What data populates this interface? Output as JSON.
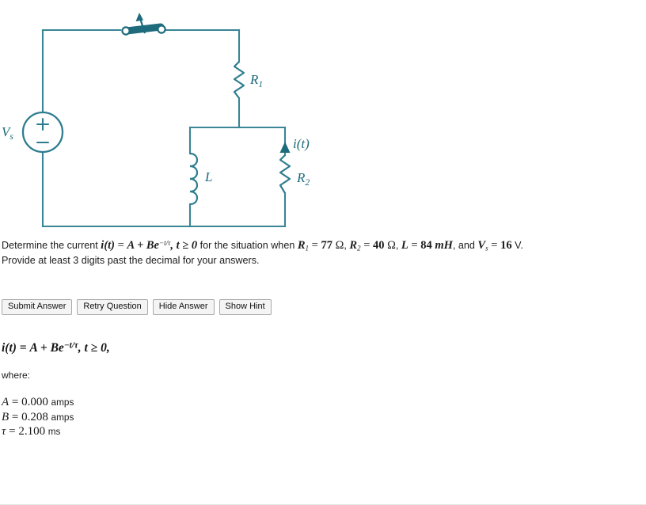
{
  "circuit": {
    "accent_color": "#2d7d8f",
    "stroke_color": "#3a8596",
    "label_color": "#1b6b7a",
    "components": {
      "source_label": "V",
      "source_sub": "s",
      "source_plus": "+",
      "source_minus": "−",
      "r1_label": "R",
      "r1_sub": "1",
      "r2_label": "R",
      "r2_sub": "2",
      "inductor_label": "L",
      "current_label": "i(t)",
      "switch_name": "switch"
    }
  },
  "problem": {
    "line1_pre": "Determine the current ",
    "eq_i": "i(t)",
    "eq_equals": " = ",
    "eq_rhs": "A + Be",
    "eq_exp": "−t/τ",
    "eq_cond": ", t ≥ 0",
    "line1_mid": " for the situation when ",
    "r1_name": "R",
    "r1_sub": "1",
    "r1_value": "77",
    "r1_unit": "Ω",
    "r2_name": "R",
    "r2_sub": "2",
    "r2_value": "40",
    "r2_unit": "Ω",
    "l_name": "L",
    "l_value": "84",
    "l_unit": "mH",
    "and_text": ", and ",
    "vs_name": "V",
    "vs_sub": "s",
    "vs_value": "16",
    "vs_unit": "V",
    "line2": "Provide at least 3 digits past the decimal for your answers."
  },
  "buttons": [
    {
      "id": "submit-answer",
      "label": "Submit Answer"
    },
    {
      "id": "retry-question",
      "label": "Retry Question"
    },
    {
      "id": "hide-answer",
      "label": "Hide Answer"
    },
    {
      "id": "show-hint",
      "label": "Show Hint"
    }
  ],
  "answer": {
    "equation_lhs": "i(t)",
    "equation_eq": " = ",
    "equation_rhs": "A + Be",
    "equation_exp": "−t/τ",
    "equation_cond": ",   t ≥ 0,",
    "where_label": "where:",
    "values": [
      {
        "symbol": "A",
        "eq": " = ",
        "number": "0.000",
        "unit": "amps"
      },
      {
        "symbol": "B",
        "eq": " = ",
        "number": "0.208",
        "unit": "amps"
      },
      {
        "symbol": "τ",
        "eq": " = ",
        "number": "2.100",
        "unit": "ms"
      }
    ]
  },
  "chart_data": {
    "type": "diagram",
    "title": "RL circuit with switch, series R1, and parallel L / R2 branch",
    "nodes": [
      "Vs source (left branch)",
      "switch (top wire)",
      "R1 (right vertical, series)",
      "L (middle vertical, parallel branch)",
      "R2 (right vertical, parallel branch, carries i(t))"
    ],
    "given": {
      "R1_ohm": 77,
      "R2_ohm": 40,
      "L_mH": 84,
      "Vs_V": 16
    },
    "solution": {
      "A_amps": 0.0,
      "B_amps": 0.208,
      "tau_ms": 2.1
    }
  }
}
